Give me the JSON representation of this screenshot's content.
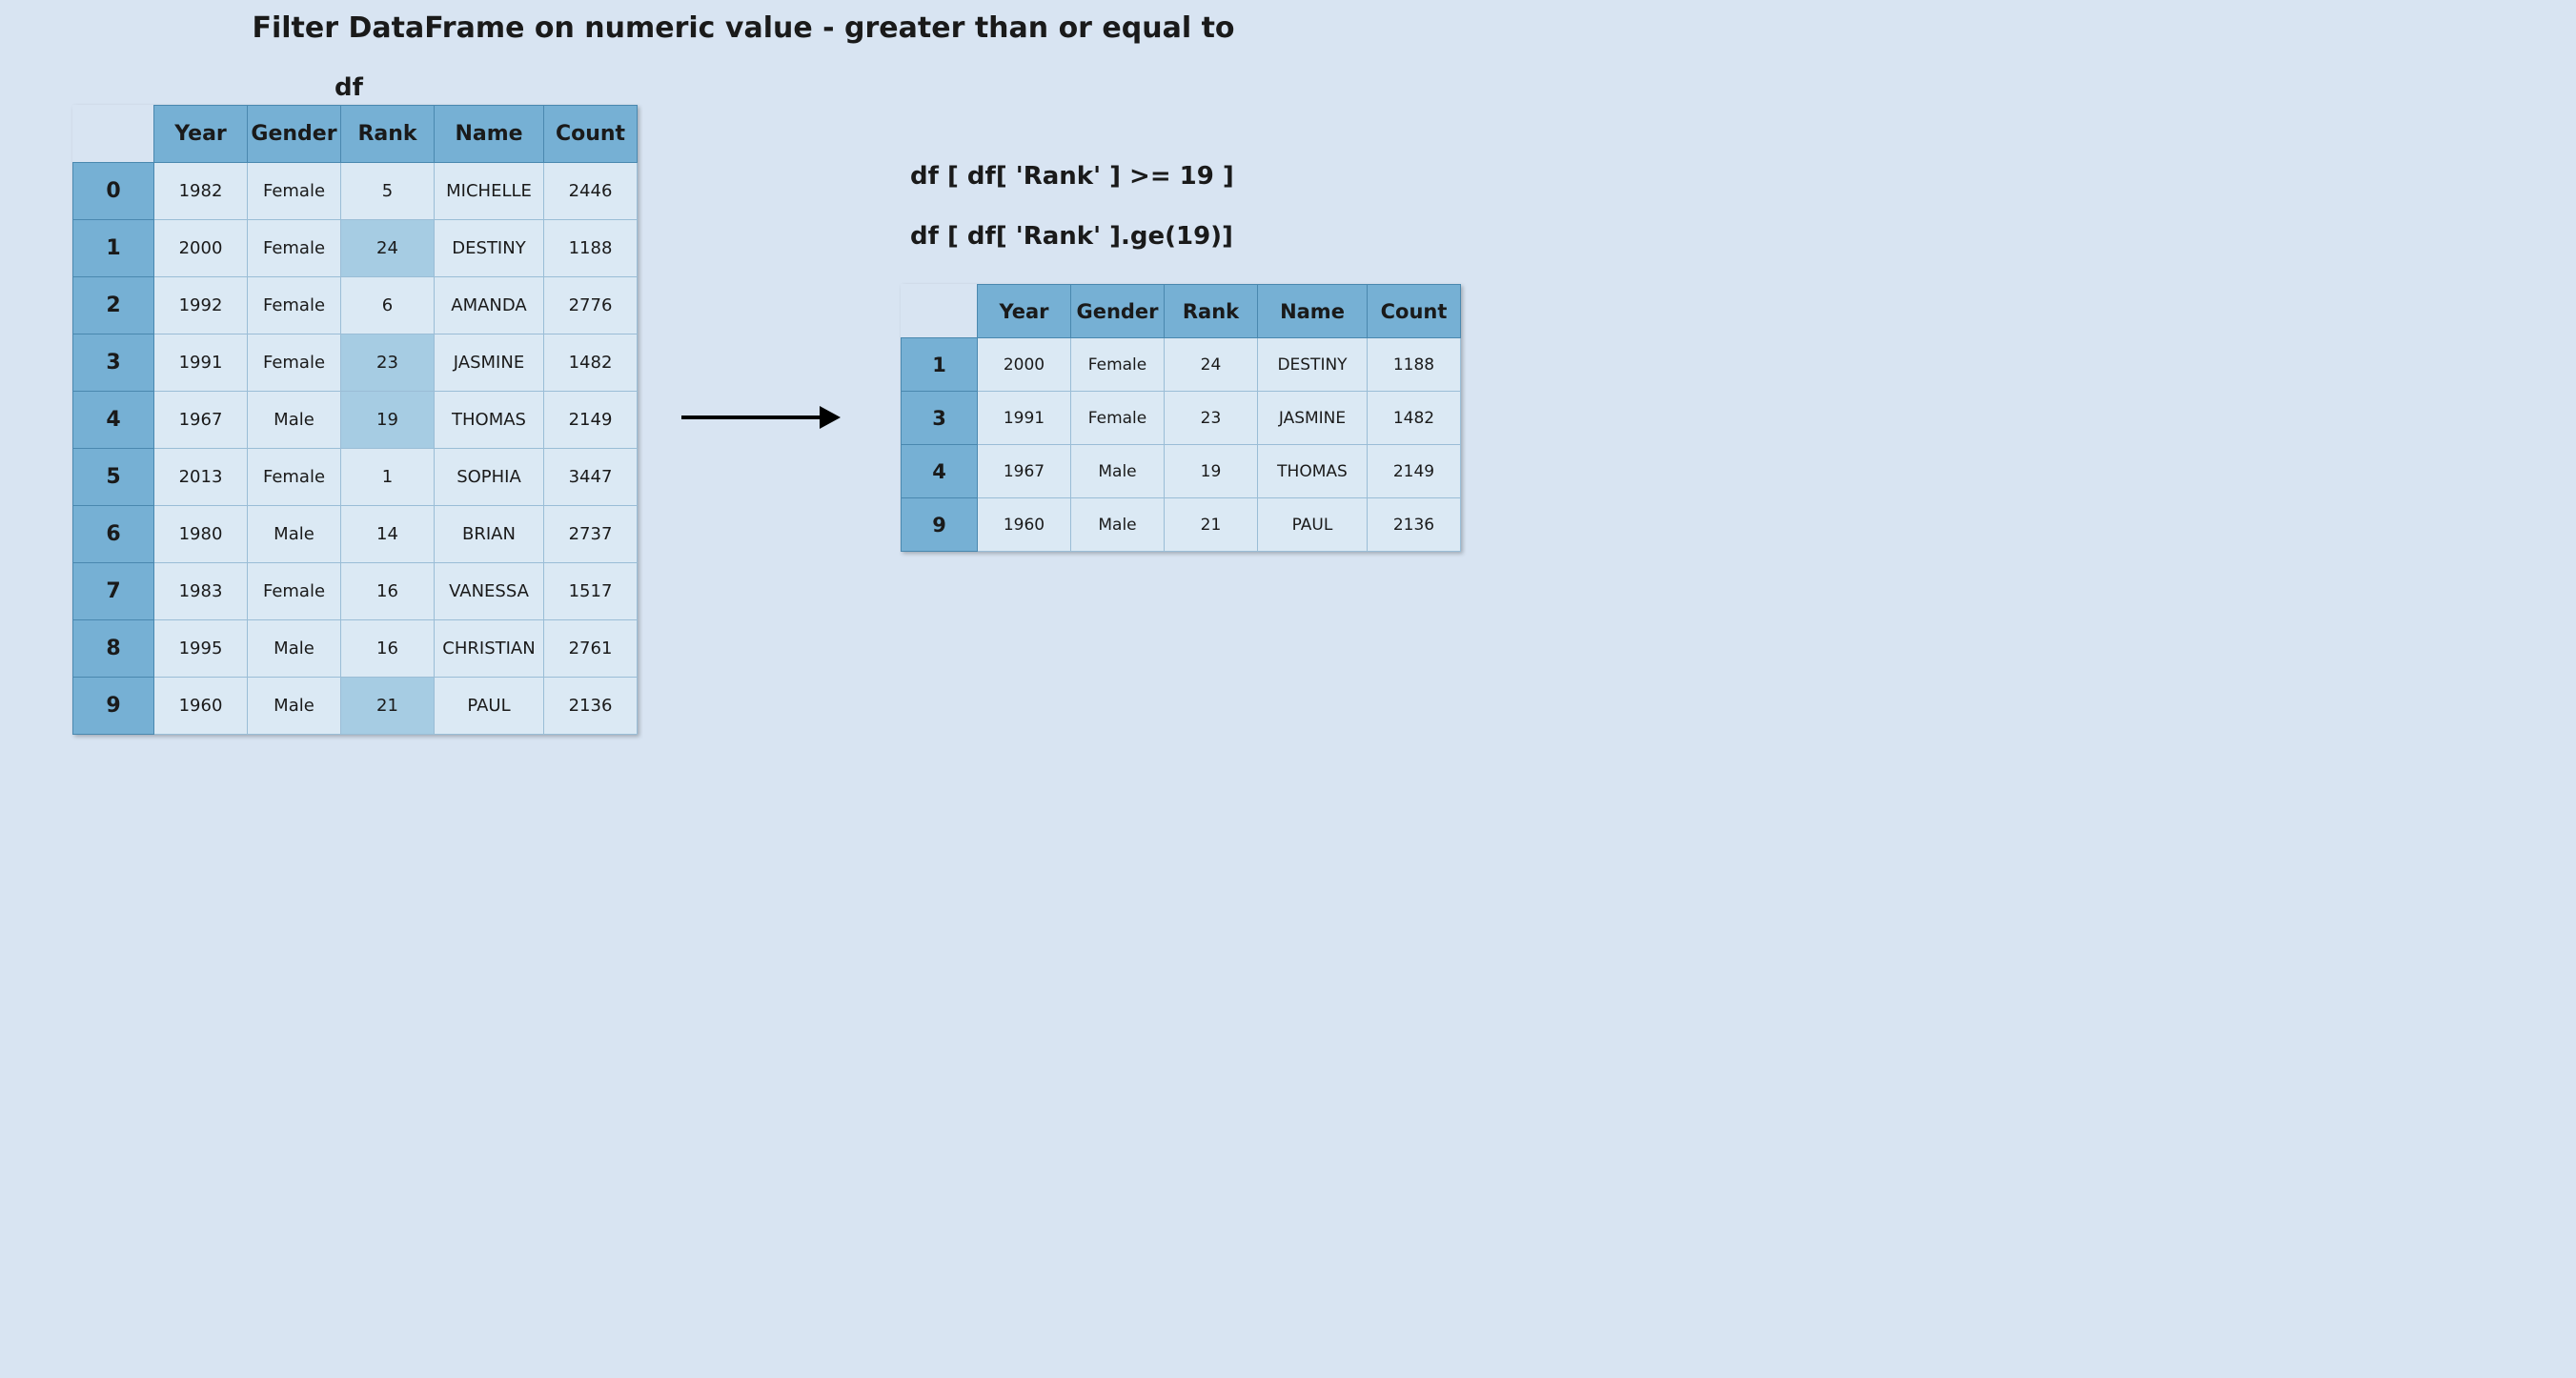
{
  "title": "Filter DataFrame on numeric value - greater than or equal to",
  "df_caption": "df",
  "columns": [
    "Year",
    "Gender",
    "Rank",
    "Name",
    "Count"
  ],
  "source_rows": [
    {
      "idx": "0",
      "cells": [
        "1982",
        "Female",
        "5",
        "MICHELLE",
        "2446"
      ],
      "hl_rank": false
    },
    {
      "idx": "1",
      "cells": [
        "2000",
        "Female",
        "24",
        "DESTINY",
        "1188"
      ],
      "hl_rank": true
    },
    {
      "idx": "2",
      "cells": [
        "1992",
        "Female",
        "6",
        "AMANDA",
        "2776"
      ],
      "hl_rank": false
    },
    {
      "idx": "3",
      "cells": [
        "1991",
        "Female",
        "23",
        "JASMINE",
        "1482"
      ],
      "hl_rank": true
    },
    {
      "idx": "4",
      "cells": [
        "1967",
        "Male",
        "19",
        "THOMAS",
        "2149"
      ],
      "hl_rank": true
    },
    {
      "idx": "5",
      "cells": [
        "2013",
        "Female",
        "1",
        "SOPHIA",
        "3447"
      ],
      "hl_rank": false
    },
    {
      "idx": "6",
      "cells": [
        "1980",
        "Male",
        "14",
        "BRIAN",
        "2737"
      ],
      "hl_rank": false
    },
    {
      "idx": "7",
      "cells": [
        "1983",
        "Female",
        "16",
        "VANESSA",
        "1517"
      ],
      "hl_rank": false
    },
    {
      "idx": "8",
      "cells": [
        "1995",
        "Male",
        "16",
        "CHRISTIAN",
        "2761"
      ],
      "hl_rank": false
    },
    {
      "idx": "9",
      "cells": [
        "1960",
        "Male",
        "21",
        "PAUL",
        "2136"
      ],
      "hl_rank": true
    }
  ],
  "result_rows": [
    {
      "idx": "1",
      "cells": [
        "2000",
        "Female",
        "24",
        "DESTINY",
        "1188"
      ]
    },
    {
      "idx": "3",
      "cells": [
        "1991",
        "Female",
        "23",
        "JASMINE",
        "1482"
      ]
    },
    {
      "idx": "4",
      "cells": [
        "1967",
        "Male",
        "19",
        "THOMAS",
        "2149"
      ]
    },
    {
      "idx": "9",
      "cells": [
        "1960",
        "Male",
        "21",
        "PAUL",
        "2136"
      ]
    }
  ],
  "code": {
    "line1": "df [ df[ 'Rank' ] >= 19 ]",
    "line2": "df [ df[ 'Rank' ].ge(19)]"
  }
}
